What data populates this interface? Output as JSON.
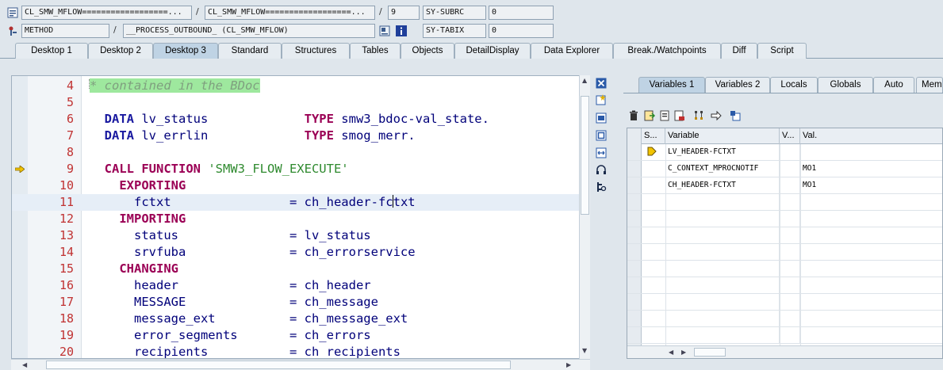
{
  "header": {
    "row1": {
      "program": "CL_SMW_MFLOW==================...",
      "include": "CL_SMW_MFLOW==================...",
      "line": "9",
      "sysfield_label": "SY-SUBRC",
      "sysfield_value": "0"
    },
    "row2": {
      "event_type": "METHOD",
      "event_name": "__PROCESS_OUTBOUND_ (CL_SMW_MFLOW)",
      "sysfield_label": "SY-TABIX",
      "sysfield_value": "0"
    },
    "separator": "/"
  },
  "desktop_tabs": [
    {
      "label": "Desktop 1"
    },
    {
      "label": "Desktop 2"
    },
    {
      "label": "Desktop 3",
      "active": true
    },
    {
      "label": "Standard"
    },
    {
      "label": "Structures"
    },
    {
      "label": "Tables"
    },
    {
      "label": "Objects"
    },
    {
      "label": "DetailDisplay"
    },
    {
      "label": "Data Explorer"
    },
    {
      "label": "Break./Watchpoints"
    },
    {
      "label": "Diff"
    },
    {
      "label": "Script"
    }
  ],
  "editor": {
    "current_line": 11,
    "breakpoint_arrow_line": 9,
    "lines": [
      {
        "num": "4",
        "parts": [
          [
            "cmt",
            "* contained in the BDoc"
          ]
        ]
      },
      {
        "num": "5",
        "parts": []
      },
      {
        "num": "6",
        "parts": [
          [
            "kwb",
            "  DATA"
          ],
          [
            "",
            " lv_status             "
          ],
          [
            "kw",
            "TYPE"
          ],
          [
            "",
            " smw3_bdoc-val_state."
          ]
        ]
      },
      {
        "num": "7",
        "parts": [
          [
            "kwb",
            "  DATA"
          ],
          [
            "",
            " lv_errlin             "
          ],
          [
            "kw",
            "TYPE"
          ],
          [
            "",
            " smog_merr."
          ]
        ]
      },
      {
        "num": "8",
        "parts": []
      },
      {
        "num": "9",
        "parts": [
          [
            "kw",
            "  CALL FUNCTION"
          ],
          [
            "",
            " "
          ],
          [
            "str",
            "'SMW3_FLOW_EXECUTE'"
          ]
        ]
      },
      {
        "num": "10",
        "parts": [
          [
            "kw",
            "    EXPORTING"
          ]
        ]
      },
      {
        "num": "11",
        "parts": [
          [
            "",
            "      fctxt                = ch_header-fc"
          ],
          [
            "cursor",
            ""
          ],
          [
            "",
            "txt"
          ]
        ]
      },
      {
        "num": "12",
        "parts": [
          [
            "kw",
            "    IMPORTING"
          ]
        ]
      },
      {
        "num": "13",
        "parts": [
          [
            "",
            "      status               = lv_status"
          ]
        ]
      },
      {
        "num": "14",
        "parts": [
          [
            "",
            "      srvfuba              = ch_errorservice"
          ]
        ]
      },
      {
        "num": "15",
        "parts": [
          [
            "kw",
            "    CHANGING"
          ]
        ]
      },
      {
        "num": "16",
        "parts": [
          [
            "",
            "      header               = ch_header"
          ]
        ]
      },
      {
        "num": "17",
        "parts": [
          [
            "",
            "      MESSAGE              = ch_message"
          ]
        ]
      },
      {
        "num": "18",
        "parts": [
          [
            "",
            "      message_ext          = ch_message_ext"
          ]
        ]
      },
      {
        "num": "19",
        "parts": [
          [
            "",
            "      error_segments       = ch_errors"
          ]
        ]
      },
      {
        "num": "20",
        "parts": [
          [
            "",
            "      recipients           = ch_recipients"
          ]
        ]
      }
    ]
  },
  "side_tools": [
    "close-icon",
    "new-tool-icon",
    "tools-icon",
    "maximize-icon",
    "swap-icon",
    "headphones-icon",
    "settings-icon"
  ],
  "variables_pane": {
    "tabs": [
      {
        "label": "Variables 1",
        "active": true
      },
      {
        "label": "Variables 2"
      },
      {
        "label": "Locals"
      },
      {
        "label": "Globals"
      },
      {
        "label": "Auto"
      },
      {
        "label": "Mem"
      }
    ],
    "toolbar": [
      "delete-icon",
      "import-icon",
      "export-icon",
      "save-icon",
      "hierarchy-icon",
      "navigate-icon",
      "hide-icon"
    ],
    "columns": [
      "S...",
      "Variable",
      "V...",
      "Val."
    ],
    "rows": [
      {
        "icon": "breakpoint-icon",
        "variable": "LV_HEADER-FCTXT",
        "v": "",
        "value": ""
      },
      {
        "icon": "",
        "variable": "C_CONTEXT_MPROCNOTIF",
        "v": "",
        "value": "MO1"
      },
      {
        "icon": "",
        "variable": "CH_HEADER-FCTXT",
        "v": "",
        "value": "MO1"
      },
      {
        "icon": "",
        "variable": "",
        "v": "",
        "value": ""
      },
      {
        "icon": "",
        "variable": "",
        "v": "",
        "value": ""
      },
      {
        "icon": "",
        "variable": "",
        "v": "",
        "value": ""
      },
      {
        "icon": "",
        "variable": "",
        "v": "",
        "value": ""
      },
      {
        "icon": "",
        "variable": "",
        "v": "",
        "value": ""
      },
      {
        "icon": "",
        "variable": "",
        "v": "",
        "value": ""
      },
      {
        "icon": "",
        "variable": "",
        "v": "",
        "value": ""
      },
      {
        "icon": "",
        "variable": "",
        "v": "",
        "value": ""
      },
      {
        "icon": "",
        "variable": "",
        "v": "",
        "value": ""
      }
    ]
  }
}
